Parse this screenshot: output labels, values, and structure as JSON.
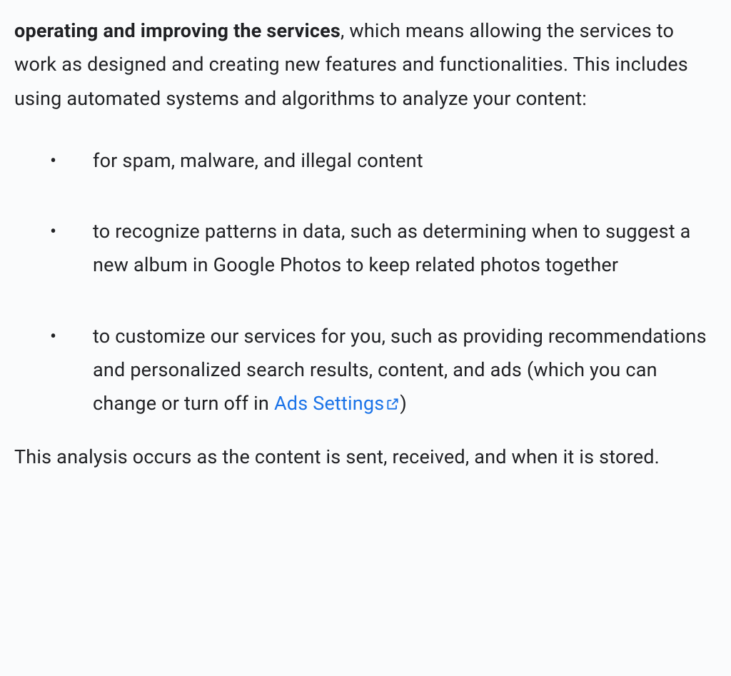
{
  "intro": {
    "bold_lead": "operating and improving the services",
    "rest": ", which means allowing the services to work as designed and creating new features and functionalities. This includes using automated systems and algorithms to analyze your content:"
  },
  "bullets": [
    {
      "text": "for spam, malware, and illegal content"
    },
    {
      "text": "to recognize patterns in data, such as determining when to suggest a new album in Google Photos to keep related photos together"
    },
    {
      "prefix": "to customize our services for you, such as providing recommendations and personalized search results, content, and ads (which you can change or turn off in ",
      "link_text": "Ads Settings",
      "suffix": ")"
    }
  ],
  "outro": "This analysis occurs as the content is sent, received, and when it is stored."
}
